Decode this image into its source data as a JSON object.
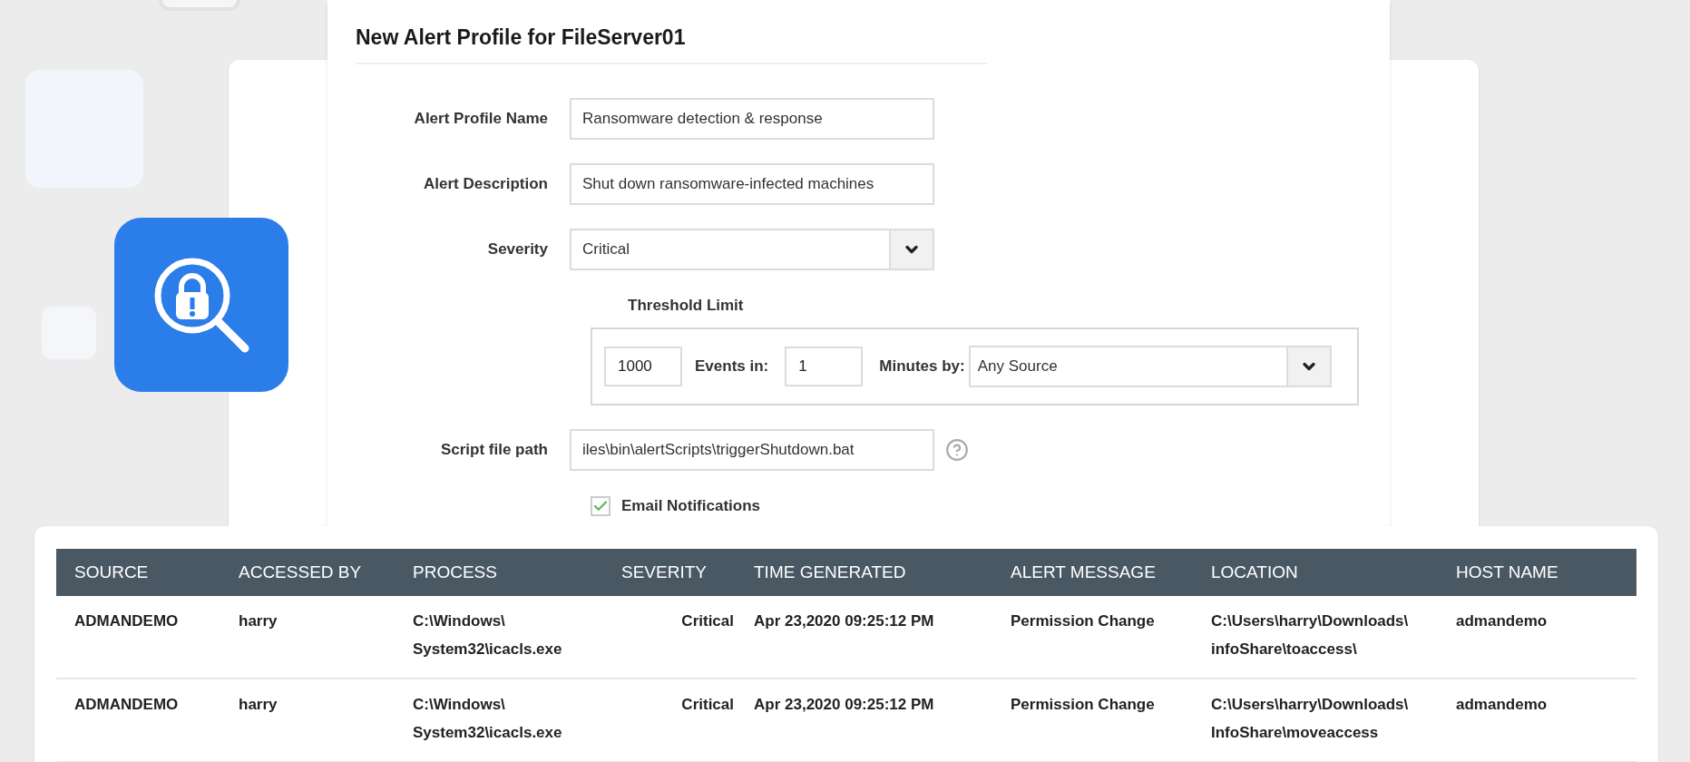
{
  "form": {
    "title": "New Alert Profile for FileServer01",
    "fields": [
      {
        "kind": "text",
        "label": "Alert Profile Name",
        "value": "Ransomware detection & response"
      },
      {
        "kind": "text",
        "label": "Alert Description",
        "value": "Shut down ransomware-infected machines"
      },
      {
        "kind": "select",
        "label": "Severity",
        "value": "Critical"
      }
    ],
    "threshold": {
      "label": "Threshold Limit",
      "count": "1000",
      "events_label": "Events in:",
      "minutes": "1",
      "minutes_label": "Minutes by:",
      "source": "Any Source"
    },
    "script": {
      "label": "Script file path",
      "value": "iles\\bin\\alertScripts\\triggerShutdown.bat"
    },
    "email": {
      "label": "Email Notifications",
      "checked": true
    }
  },
  "table": {
    "columns": [
      "SOURCE",
      "ACCESSED BY",
      "PROCESS",
      "SEVERITY",
      "TIME GENERATED",
      "ALERT MESSAGE",
      "LOCATION",
      "HOST NAME"
    ],
    "rows": [
      {
        "cells": [
          "ADMANDEMO",
          "harry",
          "C:\\Windows\\\nSystem32\\icacls.exe",
          "Critical",
          "Apr 23,2020 09:25:12 PM",
          "Permission Change",
          "C:\\Users\\harry\\Downloads\\\ninfoShare\\toaccess\\",
          "admandemo"
        ]
      },
      {
        "cells": [
          "ADMANDEMO",
          "harry",
          "C:\\Windows\\\nSystem32\\icacls.exe",
          "Critical",
          "Apr 23,2020 09:25:12 PM",
          "Permission Change",
          "C:\\Users\\harry\\Downloads\\\nInfoShare\\moveaccess",
          "admandemo"
        ]
      }
    ]
  }
}
